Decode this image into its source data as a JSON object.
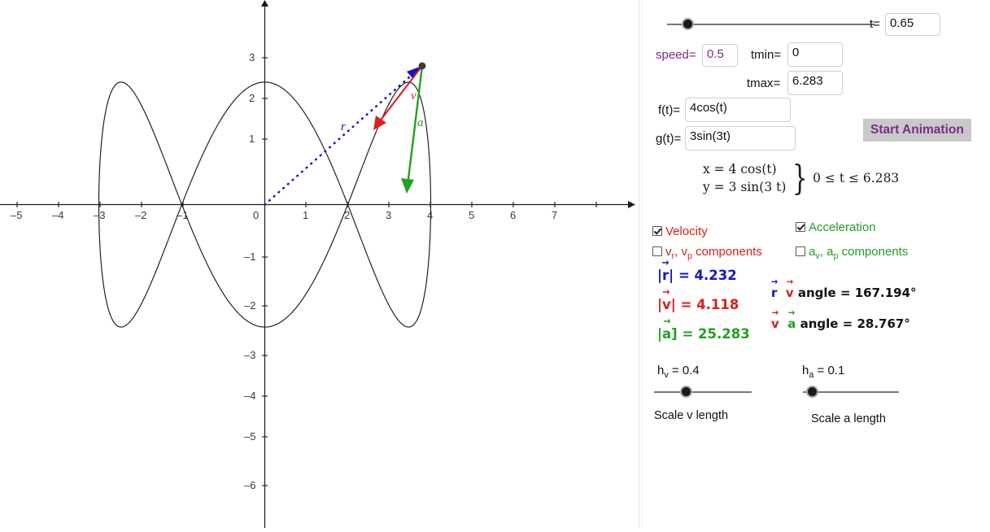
{
  "chart_data": {
    "type": "line",
    "title": "",
    "xlabel": "",
    "ylabel": "",
    "curve": "Lissajous parametric curve x = 4 cos(t), y = 3 sin(3t)",
    "parametric": {
      "x": "4 cos(t)",
      "y": "3 sin(3 t)",
      "t_min": 0,
      "t_max": 6.283
    },
    "xlim": [
      -5.6,
      7.4
    ],
    "ylim": [
      -6.6,
      3.55
    ],
    "xticks": [
      -5,
      -4,
      -3,
      -2,
      -1,
      0,
      1,
      2,
      3,
      4,
      5,
      6,
      7
    ],
    "yticks": [
      3,
      2,
      1,
      0,
      -1,
      -2,
      -3,
      -4,
      -5,
      -6
    ],
    "grid": false,
    "legend": "none",
    "point": {
      "label": "",
      "t": 0.65,
      "x": 3.166,
      "y": 2.784
    },
    "vectors": [
      {
        "name": "r",
        "label": "r",
        "color": "#1414c8",
        "style": "dotted",
        "from": [
          0,
          0
        ],
        "to": [
          3.166,
          2.784
        ]
      },
      {
        "name": "v",
        "label": "v",
        "color": "#d8211a",
        "style": "solid",
        "from": [
          3.166,
          2.784
        ],
        "to": [
          1.92,
          1.54
        ]
      },
      {
        "name": "a",
        "label": "a",
        "color": "#22a01f",
        "style": "solid",
        "from": [
          3.166,
          2.784
        ],
        "to": [
          2.9,
          0.33
        ]
      }
    ]
  },
  "graph": {
    "axis_x_labels": [
      "–5",
      "–4",
      "–3",
      "–2",
      "–1",
      "0",
      "1",
      "2",
      "3",
      "4",
      "5",
      "6",
      "7"
    ],
    "axis_y_labels": [
      "3",
      "2",
      "1",
      "–1",
      "–2",
      "–3",
      "–4",
      "–5",
      "–6"
    ],
    "origin_label": "0",
    "r_label": "r",
    "v_label": "v",
    "a_label": "a"
  },
  "controls": {
    "t_label": "t=",
    "t_value": "0.65",
    "t_slider_percent": 10,
    "speed_label": "speed=",
    "speed_value": "0.5",
    "tmin_label": "tmin=",
    "tmin_value": "0",
    "tmax_label": "tmax=",
    "tmax_value": "6.283",
    "ft_label": "f(t)=",
    "ft_value": "4cos(t)",
    "gt_label": "g(t)=",
    "gt_value": "3sin(3t)",
    "start_animation_label": "Start Animation"
  },
  "equations": {
    "line1": "x = 4  cos(t)",
    "line2": "y = 3  sin(3 t)",
    "range": "0 ≤ t ≤ 6.283"
  },
  "checkboxes": [
    {
      "name": "velocity",
      "label": "Velocity",
      "checked": true,
      "color": "#d8211a"
    },
    {
      "name": "acceleration",
      "label": "Acceleration",
      "checked": true,
      "color": "#22a01f"
    },
    {
      "name": "v-components",
      "label_html": "v<sub>r</sub>, v<sub>p</sub> components",
      "checked": false,
      "color": "#d8211a"
    },
    {
      "name": "a-components",
      "label_html": "a<sub>v</sub>, a<sub>p</sub> components",
      "checked": false,
      "color": "#22a01f"
    }
  ],
  "readouts": {
    "r_magnitude_value": "= 4.232",
    "v_magnitude_value": "= 4.118",
    "a_magnitude_value": "= 25.283",
    "r_symbol": "r",
    "v_symbol": "v",
    "a_symbol": "a",
    "rv_angle_text": "angle = 167.194°",
    "va_angle_text": "angle = 28.767°"
  },
  "scale_sliders": [
    {
      "name": "scale-v",
      "value_label": "h",
      "sub": "v",
      "value": "= 0.4",
      "percent": 33,
      "caption": "Scale v length"
    },
    {
      "name": "scale-a",
      "value_label": "h",
      "sub": "a",
      "value": "= 0.1",
      "percent": 10,
      "caption": "Scale a length"
    }
  ],
  "colors": {
    "r": "#1414c8",
    "v": "#d8211a",
    "a": "#22a01f",
    "accent_purple": "#7c2d8b",
    "button_bg": "#c9c9c9"
  }
}
